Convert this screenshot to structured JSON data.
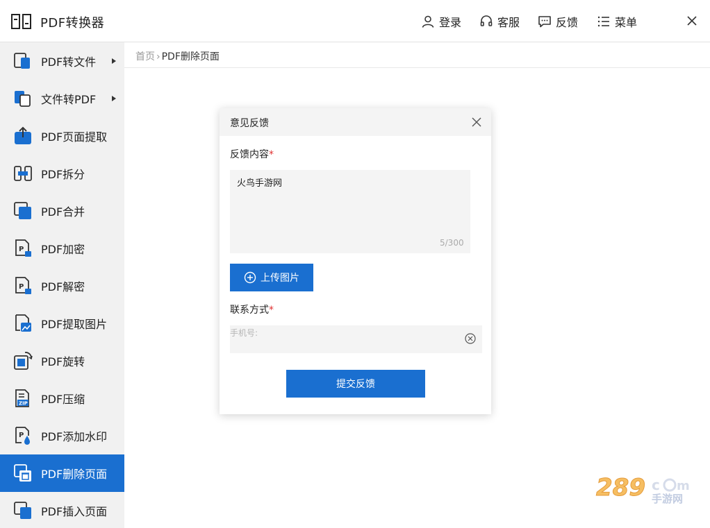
{
  "app": {
    "title": "PDF转换器"
  },
  "toolbar": {
    "login": "登录",
    "service": "客服",
    "feedback": "反馈",
    "menu": "菜单"
  },
  "sidebar": {
    "items": [
      {
        "label": "PDF转文件",
        "has_arrow": true
      },
      {
        "label": "文件转PDF",
        "has_arrow": true
      },
      {
        "label": "PDF页面提取"
      },
      {
        "label": "PDF拆分"
      },
      {
        "label": "PDF合并"
      },
      {
        "label": "PDF加密"
      },
      {
        "label": "PDF解密"
      },
      {
        "label": "PDF提取图片"
      },
      {
        "label": "PDF旋转"
      },
      {
        "label": "PDF压缩"
      },
      {
        "label": "PDF添加水印"
      },
      {
        "label": "PDF删除页面",
        "active": true
      },
      {
        "label": "PDF插入页面"
      }
    ]
  },
  "breadcrumb": {
    "home": "首页",
    "current": "PDF删除页面"
  },
  "dialog": {
    "title": "意见反馈",
    "content_label": "反馈内容",
    "content_value": "火鸟手游网",
    "counter": "5/300",
    "upload_label": "上传图片",
    "contact_label": "联系方式",
    "phone_placeholder": "手机号:",
    "submit_label": "提交反馈"
  },
  "watermark": {
    "text": "289.com",
    "subtext": "手游网"
  },
  "colors": {
    "accent": "#1a6fd0",
    "sidebar_bg": "#f1f1f1",
    "required": "#e03030"
  }
}
